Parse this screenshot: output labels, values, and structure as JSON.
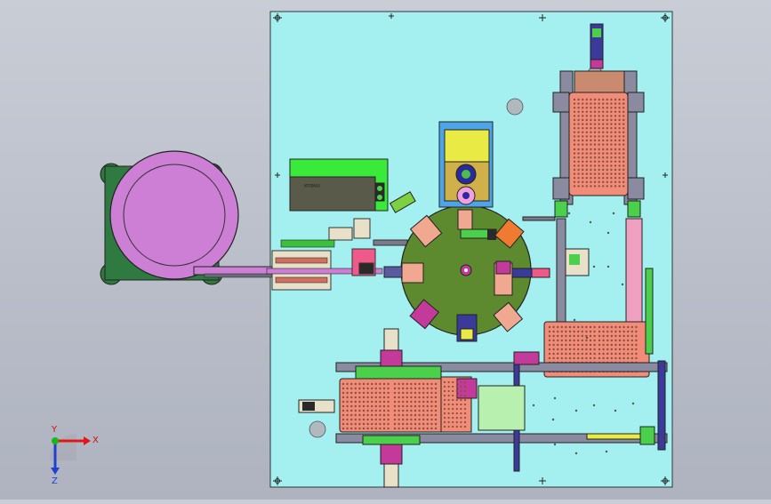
{
  "viewport": {
    "background_top": "#c9cdd6",
    "background_bottom": "#aeb3bf"
  },
  "model": {
    "base_plate_color": "#a4f0f0",
    "rotary_table_color": "#5d8a2e",
    "feeder_bowl_color": "#cc7fd4",
    "tray_color": "#f08c78",
    "frame_color": "#8a8aa0",
    "display_color": "#3aea3a",
    "display_text": "MTRMAV"
  },
  "triad": {
    "x_label": "X",
    "y_label": "Y",
    "z_label": "Z",
    "x_color": "#e01818",
    "y_color": "#18b818",
    "z_color": "#2040d0"
  }
}
